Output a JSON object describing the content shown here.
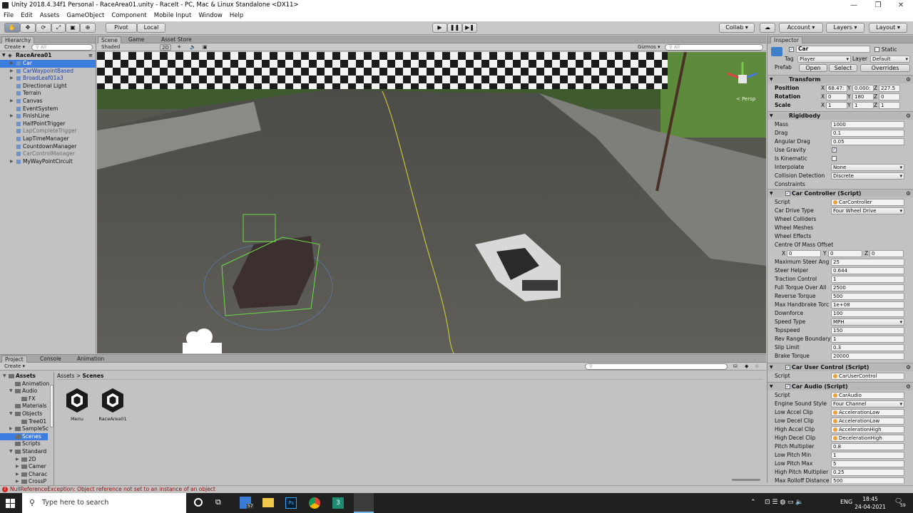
{
  "window": {
    "title": "Unity 2018.4.34f1 Personal - RaceArea01.unity - RaceIt - PC, Mac & Linux Standalone <DX11>",
    "min": "—",
    "max": "❐",
    "close": "✕"
  },
  "menu": [
    "File",
    "Edit",
    "Assets",
    "GameObject",
    "Component",
    "Mobile Input",
    "Window",
    "Help"
  ],
  "toolbar": {
    "pivot": "Pivot",
    "local": "Local",
    "collab": "Collab ▾",
    "account": "Account ▾",
    "layers": "Layers ▾",
    "layout": "Layout ▾"
  },
  "hierarchy": {
    "tab": "Hierarchy",
    "create": "Create ▾",
    "search": "All",
    "scene": "RaceArea01",
    "items": [
      {
        "label": "Car",
        "arrow": "▶",
        "indent": 1,
        "sel": true,
        "color": "#ffffff"
      },
      {
        "label": "CarWaypointBased",
        "arrow": "▶",
        "indent": 1,
        "color": "#1f3fa8"
      },
      {
        "label": "BroadLeaf01a3",
        "arrow": "▶",
        "indent": 1,
        "color": "#1f3fa8"
      },
      {
        "label": "Directional Light",
        "arrow": "",
        "indent": 1,
        "color": "#111111"
      },
      {
        "label": "Terrain",
        "arrow": "",
        "indent": 1,
        "color": "#111111"
      },
      {
        "label": "Canvas",
        "arrow": "▶",
        "indent": 1,
        "color": "#111111"
      },
      {
        "label": "EventSystem",
        "arrow": "",
        "indent": 1,
        "color": "#111111"
      },
      {
        "label": "FinishLine",
        "arrow": "▶",
        "indent": 1,
        "color": "#111111"
      },
      {
        "label": "HalfPointTrigger",
        "arrow": "",
        "indent": 1,
        "color": "#111111"
      },
      {
        "label": "LapCompleteTrigger",
        "arrow": "",
        "indent": 1,
        "color": "#6d6d6d"
      },
      {
        "label": "LapTimeManager",
        "arrow": "",
        "indent": 1,
        "color": "#111111"
      },
      {
        "label": "CountdownManager",
        "arrow": "",
        "indent": 1,
        "color": "#111111"
      },
      {
        "label": "CarControlManager",
        "arrow": "",
        "indent": 1,
        "color": "#6d6d6d"
      },
      {
        "label": "MyWayPointCircuit",
        "arrow": "▶",
        "indent": 1,
        "color": "#111111"
      }
    ]
  },
  "scene": {
    "tabs": [
      "Scene",
      "Game",
      "Asset Store"
    ],
    "shaded": "Shaded",
    "mode2d": "2D",
    "gizmos": "Gizmos ▾",
    "search": "All",
    "persp": "< Persp"
  },
  "inspector": {
    "tab": "Inspector",
    "name": "Car",
    "static": "Static",
    "tag_label": "Tag",
    "tag": "Player",
    "layer_label": "Layer",
    "layer": "Default",
    "prefab_label": "Prefab",
    "open": "Open",
    "select": "Select",
    "overrides": "Overrides",
    "transform": {
      "title": "Transform",
      "position": "Position",
      "rotation": "Rotation",
      "scale": "Scale",
      "pos": [
        "68.47:",
        "0.000:",
        "227.5"
      ],
      "rot": [
        "0",
        "180",
        "0"
      ],
      "scl": [
        "1",
        "1",
        "1"
      ]
    },
    "rigidbody": {
      "title": "Rigidbody",
      "rows": [
        [
          "Mass",
          "1000"
        ],
        [
          "Drag",
          "0.1"
        ],
        [
          "Angular Drag",
          "0.05"
        ],
        [
          "Use Gravity",
          "✓"
        ],
        [
          "Is Kinematic",
          ""
        ],
        [
          "Interpolate",
          "None"
        ],
        [
          "Collision Detection",
          "Discrete"
        ],
        [
          "Constraints",
          ""
        ]
      ]
    },
    "carcontroller": {
      "title": "Car Controller (Script)",
      "script": "CarController",
      "rows": [
        [
          "Script",
          "CarController"
        ],
        [
          "Car Drive Type",
          "Four Wheel Drive"
        ],
        [
          "Wheel Colliders",
          ""
        ],
        [
          "Wheel Meshes",
          ""
        ],
        [
          "Wheel Effects",
          ""
        ],
        [
          "Centre Of Mass Offset",
          ""
        ]
      ],
      "com": [
        "0",
        "0",
        "0"
      ],
      "rows2": [
        [
          "Maximum Steer Ang",
          "25"
        ],
        [
          "Steer Helper",
          "0.644"
        ],
        [
          "Traction Control",
          "1"
        ],
        [
          "Full Torque Over All",
          "2500"
        ],
        [
          "Reverse Torque",
          "500"
        ],
        [
          "Max Handbrake Torc",
          "1e+08"
        ],
        [
          "Downforce",
          "100"
        ],
        [
          "Speed Type",
          "MPH"
        ],
        [
          "Topspeed",
          "150"
        ],
        [
          "Rev Range Boundary",
          "1"
        ],
        [
          "Slip Limit",
          "0.3"
        ],
        [
          "Brake Torque",
          "20000"
        ]
      ]
    },
    "caruser": {
      "title": "Car User Control (Script)",
      "script_label": "Script",
      "script": "CarUserControl"
    },
    "caraudio": {
      "title": "Car Audio (Script)",
      "rows": [
        [
          "Script",
          "CarAudio"
        ],
        [
          "Engine Sound Style",
          "Four Channel"
        ],
        [
          "Low Accel Clip",
          "AccelerationLow"
        ],
        [
          "Low Decel Clip",
          "AccelerationLow"
        ],
        [
          "High Accel Clip",
          "AccelerationHigh"
        ],
        [
          "High Decel Clip",
          "DecelerationHigh"
        ],
        [
          "Pitch Multiplier",
          "0.8"
        ],
        [
          "Low Pitch Min",
          "1"
        ],
        [
          "Low Pitch Max",
          "5"
        ],
        [
          "High Pitch Multiplier",
          "0.25"
        ],
        [
          "Max Rolloff Distance",
          "500"
        ]
      ]
    }
  },
  "project": {
    "tabs": [
      "Project",
      "Console",
      "Animation"
    ],
    "create": "Create ▾",
    "breadcrumb": [
      "Assets",
      "Scenes"
    ],
    "tree": [
      {
        "label": "Assets",
        "arrow": "▼",
        "indent": 0,
        "bold": true
      },
      {
        "label": "Animation",
        "arrow": "",
        "indent": 1
      },
      {
        "label": "Audio",
        "arrow": "▼",
        "indent": 1
      },
      {
        "label": "FX",
        "arrow": "",
        "indent": 2
      },
      {
        "label": "Materials",
        "arrow": "",
        "indent": 1
      },
      {
        "label": "Objects",
        "arrow": "▼",
        "indent": 1
      },
      {
        "label": "Tree01",
        "arrow": "",
        "indent": 2
      },
      {
        "label": "SampleSc",
        "arrow": "▶",
        "indent": 1
      },
      {
        "label": "Scenes",
        "arrow": "",
        "indent": 1,
        "sel": true
      },
      {
        "label": "Scripts",
        "arrow": "",
        "indent": 1
      },
      {
        "label": "Standard",
        "arrow": "▼",
        "indent": 1
      },
      {
        "label": "2D",
        "arrow": "▶",
        "indent": 2
      },
      {
        "label": "Camer",
        "arrow": "▶",
        "indent": 2
      },
      {
        "label": "Charac",
        "arrow": "▶",
        "indent": 2
      },
      {
        "label": "CrossP",
        "arrow": "▶",
        "indent": 2
      }
    ],
    "assets": [
      "Menu",
      "RaceArea01"
    ]
  },
  "status": {
    "error": "NullReferenceException: Object reference not set to an instance of an object"
  },
  "taskbar": {
    "search": "Type here to search",
    "time": "18:45",
    "date": "24-04-2021",
    "lang": "ENG",
    "badge": "57",
    "notif": "59"
  }
}
